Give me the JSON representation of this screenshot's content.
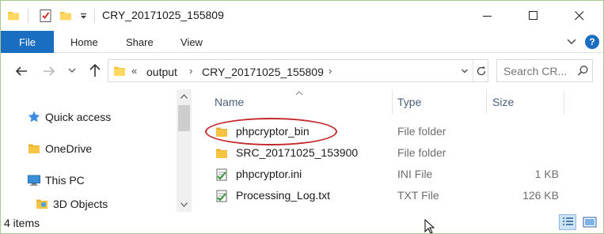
{
  "window": {
    "title": "CRY_20171025_155809",
    "controls": {
      "minimize": "minimize-icon",
      "maximize": "maximize-icon",
      "close": "close-icon"
    }
  },
  "quick_access_toolbar": {
    "icons": [
      "folder-icon",
      "properties-icon",
      "new-folder-icon",
      "chevron-down-icon"
    ]
  },
  "ribbon": {
    "tabs": [
      {
        "label": "File",
        "active": true
      },
      {
        "label": "Home"
      },
      {
        "label": "Share"
      },
      {
        "label": "View"
      }
    ],
    "help_label": "?"
  },
  "address_bar": {
    "overflow": "«",
    "path": [
      "output",
      "CRY_20171025_155809"
    ],
    "separator": "›"
  },
  "search": {
    "placeholder": "Search CR..."
  },
  "navigation_pane": {
    "items": [
      {
        "label": "Quick access",
        "icon": "star-icon"
      },
      {
        "label": "OneDrive",
        "icon": "folder-icon"
      },
      {
        "label": "This PC",
        "icon": "computer-icon"
      },
      {
        "label": "3D Objects",
        "icon": "3d-objects-icon"
      }
    ]
  },
  "file_list": {
    "columns": {
      "name": "Name",
      "type": "Type",
      "size": "Size"
    },
    "rows": [
      {
        "name": "phpcryptor_bin",
        "type": "File folder",
        "size": "",
        "icon": "folder-icon",
        "highlighted": true
      },
      {
        "name": "SRC_20171025_153900",
        "type": "File folder",
        "size": "",
        "icon": "folder-icon"
      },
      {
        "name": "phpcryptor.ini",
        "type": "INI File",
        "size": "1 KB",
        "icon": "ini-file-icon"
      },
      {
        "name": "Processing_Log.txt",
        "type": "TXT File",
        "size": "126 KB",
        "icon": "txt-file-icon"
      }
    ]
  },
  "status_bar": {
    "item_count": "4 items"
  },
  "colors": {
    "accent": "#1a6ec2",
    "folder": "#f6c443",
    "annotation": "#c3272b",
    "header_text": "#4c607a"
  }
}
